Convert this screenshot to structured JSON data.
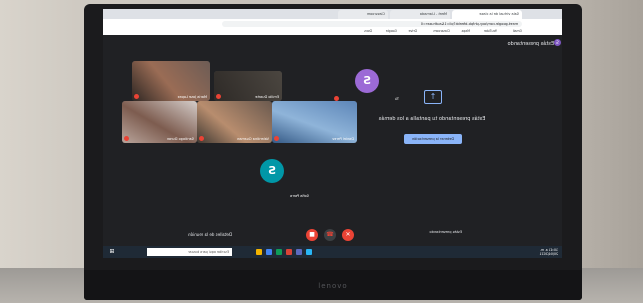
{
  "browser": {
    "tabs": [
      "Sala virtual de la clase",
      "Meet - Llamada",
      "Classroom"
    ],
    "url": "meet.google.com/oxy-phfpb-bfeebk?pli=1&authuser=0",
    "bookmarks": [
      "Gmail",
      "YouTube",
      "Maps",
      "Classroom",
      "Drive",
      "Google",
      "Docs"
    ]
  },
  "meet": {
    "presenting_label": "Estás presentando",
    "presenting_avatar": "S",
    "present_message": "Estás presentando tu pantalla a los demás",
    "stop_button": "Detener la presentación",
    "participants": [
      {
        "name": "Sofia Parra",
        "avatar": "S",
        "type": "avatar",
        "color": "#0097a7"
      },
      {
        "name": "Tú",
        "avatar": "S",
        "type": "avatar",
        "color": "#9c6ad6"
      },
      {
        "name": "Daniel Perez",
        "type": "photo"
      },
      {
        "name": "Valentina Guzman",
        "type": "photo"
      },
      {
        "name": "Emilio Duarte",
        "type": "photo"
      },
      {
        "name": "Santiago Duran",
        "type": "photo"
      },
      {
        "name": "Maria Jose Lopez",
        "type": "photo"
      }
    ]
  },
  "controls": {
    "meeting_details": "Detalles de la reunión",
    "present_now": "Estás presentando",
    "mic_color": "#ea4335",
    "cam_color": "#ea4335"
  },
  "taskbar": {
    "search_placeholder": "Escribe aquí para buscar",
    "time": "10:41 a. m.",
    "date": "20/04/2021"
  },
  "laptop_brand": "lenovo"
}
